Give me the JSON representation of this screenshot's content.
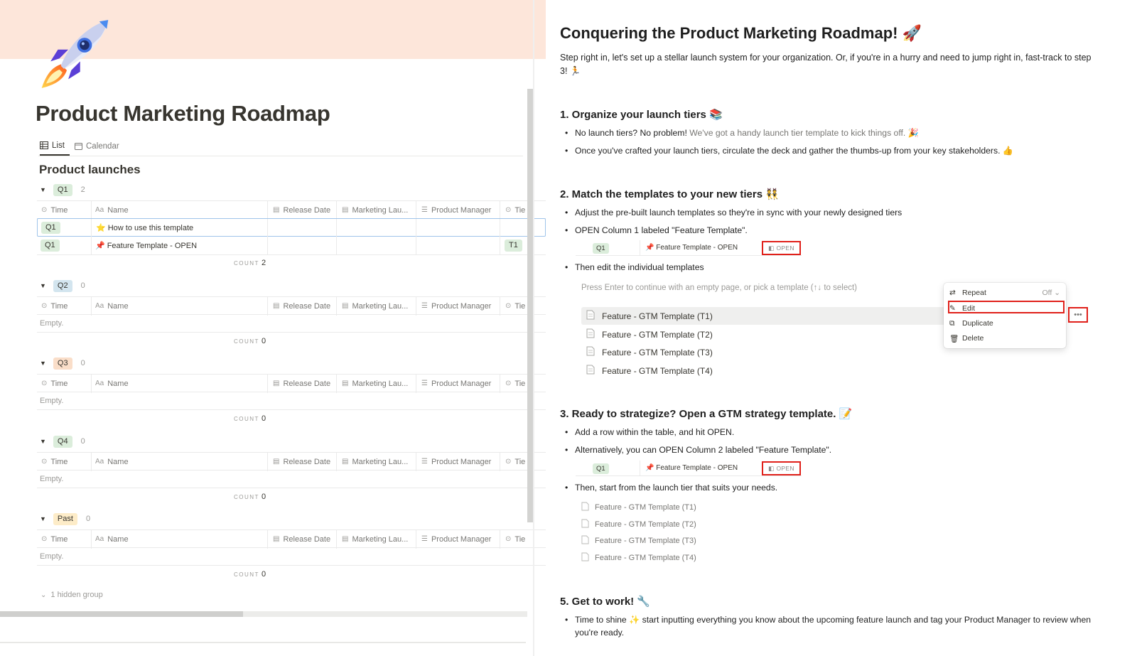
{
  "left": {
    "page_title": "Product Marketing Roadmap",
    "views": [
      {
        "label": "List"
      },
      {
        "label": "Calendar"
      }
    ],
    "section_title": "Product launches",
    "columns": {
      "time": "Time",
      "name": "Name",
      "release": "Release Date",
      "marketing": "Marketing Lau...",
      "pm": "Product Manager",
      "tier": "Tie"
    },
    "groups": [
      {
        "label": "Q1",
        "count": "2",
        "color": "#dbeddb",
        "footer_count": "2",
        "rows": [
          {
            "time": "Q1",
            "icon": "⭐",
            "name": "How to use this template",
            "tier": ""
          },
          {
            "time": "Q1",
            "icon": "📌",
            "name": "Feature Template - OPEN",
            "tier": "T1"
          }
        ]
      },
      {
        "label": "Q2",
        "count": "0",
        "color": "#d3e5ef",
        "footer_count": "0",
        "empty": "Empty."
      },
      {
        "label": "Q3",
        "count": "0",
        "color": "#fadec9",
        "footer_count": "0",
        "empty": "Empty."
      },
      {
        "label": "Q4",
        "count": "0",
        "color": "#dbeddb",
        "footer_count": "0",
        "empty": "Empty."
      },
      {
        "label": "Past",
        "count": "0",
        "color": "#fdecc8",
        "footer_count": "0",
        "empty": "Empty."
      }
    ],
    "count_label": "COUNT",
    "hidden_group": "1 hidden group"
  },
  "right": {
    "title": "Conquering the Product Marketing Roadmap! 🚀",
    "intro": "Step right in, let's set up a stellar launch system for your organization. Or, if you're in a hurry and need to jump right in, fast-track to step 3! 🏃",
    "step1": {
      "heading": "1. Organize your launch tiers 📚",
      "b1_text": "No launch tiers? No problem! ",
      "b1_link": "We've got a handy launch tier template to kick things off. 🎉",
      "b2": "Once you've crafted your launch tiers, circulate the deck and gather the thumbs-up from your key stakeholders. 👍"
    },
    "step2": {
      "heading": "2. Match the templates to your new tiers 👯",
      "b1": "Adjust the pre-built launch templates so they're in sync with your newly designed tiers",
      "b2": "OPEN Column 1 labeled \"Feature Template\".",
      "b3": "Then edit the individual templates",
      "picker_hint": "Press Enter to continue with an empty page, or pick a template (↑↓ to select)",
      "templates": [
        "Feature - GTM Template (T1)",
        "Feature - GTM Template (T2)",
        "Feature - GTM Template (T3)",
        "Feature - GTM Template (T4)"
      ],
      "menu": {
        "repeat": "Repeat",
        "repeat_value": "Off",
        "edit": "Edit",
        "duplicate": "Duplicate",
        "delete": "Delete"
      }
    },
    "mini_row": {
      "tag": "Q1",
      "name": "📌 Feature Template - OPEN",
      "open": "OPEN"
    },
    "step3": {
      "heading": "3. Ready to strategize? Open a GTM strategy template. 📝",
      "b1": "Add a row within the table, and hit OPEN.",
      "b2": "Alternatively, you can OPEN Column 2 labeled \"Feature Template\".",
      "b3": "Then, start from the launch tier that suits your needs.",
      "templates": [
        "Feature - GTM Template (T1)",
        "Feature - GTM Template (T2)",
        "Feature - GTM Template (T3)",
        "Feature - GTM Template (T4)"
      ]
    },
    "step5": {
      "heading": "5. Get to work! 🔧",
      "b1": "Time to shine ✨ start inputting everything you know about the upcoming feature launch and tag your Product Manager to review when you're ready."
    }
  },
  "colors": {
    "highlight_red": "#e0201a",
    "cover": "#fde6da",
    "selection": "#9fc4ea"
  }
}
